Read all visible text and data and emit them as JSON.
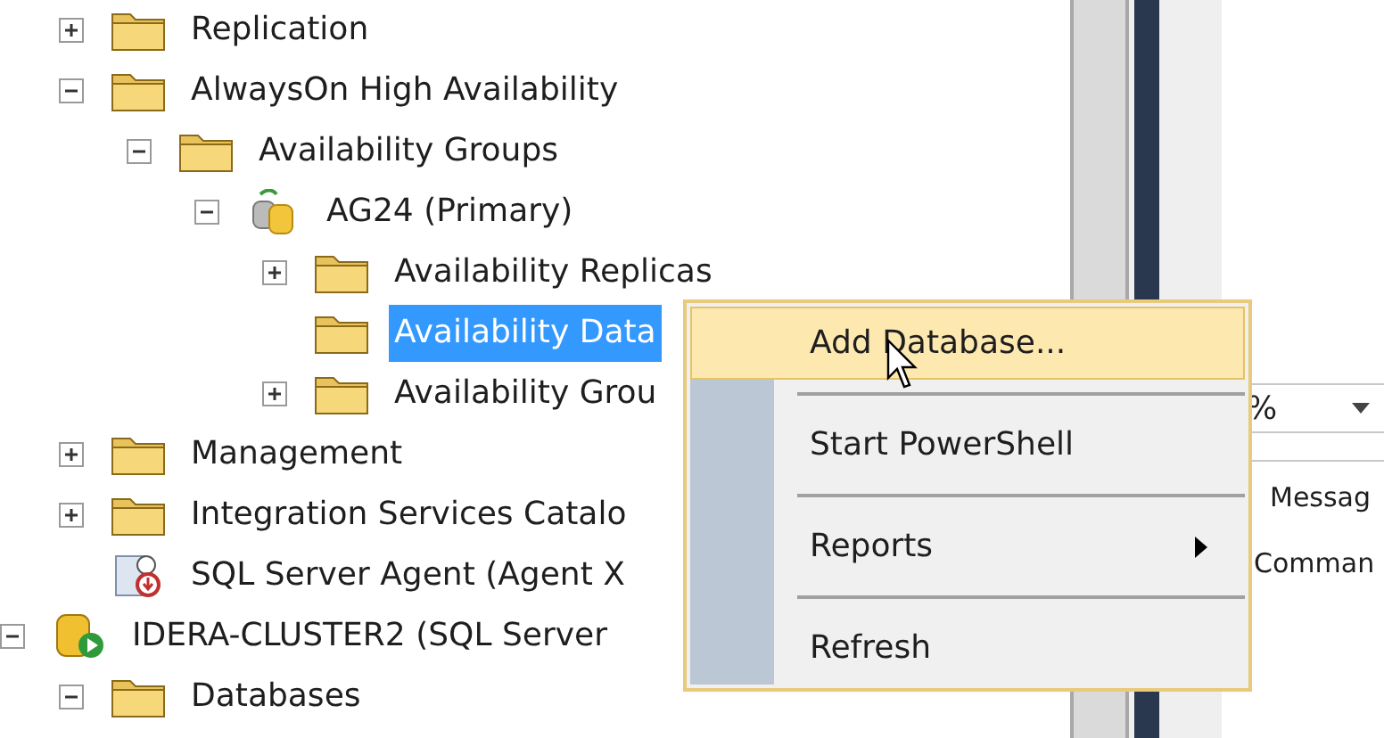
{
  "tree": {
    "continued_children": [
      {
        "label": "Replication",
        "kind": "folder",
        "expanded": false,
        "selected": false
      },
      {
        "label": "AlwaysOn High Availability",
        "kind": "folder",
        "expanded": true,
        "selected": false,
        "children": [
          {
            "label": "Availability Groups",
            "kind": "folder",
            "expanded": true,
            "selected": false,
            "children": [
              {
                "label": "AG24 (Primary)",
                "kind": "availability-group",
                "expanded": true,
                "selected": false,
                "children": [
                  {
                    "label": "Availability Replicas",
                    "kind": "folder",
                    "expanded": false,
                    "selected": false
                  },
                  {
                    "label": "Availability Data",
                    "kind": "folder",
                    "selected": true
                  },
                  {
                    "label": "Availability Grou",
                    "kind": "folder",
                    "expanded": false,
                    "selected": false
                  }
                ]
              }
            ]
          }
        ]
      },
      {
        "label": "Management",
        "kind": "folder",
        "expanded": false,
        "selected": false
      },
      {
        "label": "Integration Services Catalo",
        "kind": "folder",
        "expanded": false,
        "selected": false
      },
      {
        "label": "SQL Server Agent (Agent X",
        "kind": "agent",
        "selected": false
      }
    ],
    "nodes": [
      {
        "label": "IDERA-CLUSTER2 (SQL Server",
        "kind": "server",
        "expanded": true,
        "selected": false,
        "children": [
          {
            "label": "Databases",
            "kind": "folder",
            "expanded": true,
            "selected": false
          }
        ]
      }
    ]
  },
  "right_pane": {
    "zoom_combo": {
      "value": "%"
    },
    "tabs": [
      "Messag",
      "Comman"
    ]
  },
  "context_menu": [
    {
      "kind": "item",
      "label": "Add Database...",
      "selected": true,
      "submenu": false
    },
    {
      "kind": "separator"
    },
    {
      "kind": "item",
      "label": "Start PowerShell",
      "selected": false,
      "submenu": false
    },
    {
      "kind": "separator"
    },
    {
      "kind": "item",
      "label": "Reports",
      "selected": false,
      "submenu": true
    },
    {
      "kind": "separator"
    },
    {
      "kind": "item",
      "label": "Refresh",
      "selected": false,
      "submenu": false
    }
  ]
}
